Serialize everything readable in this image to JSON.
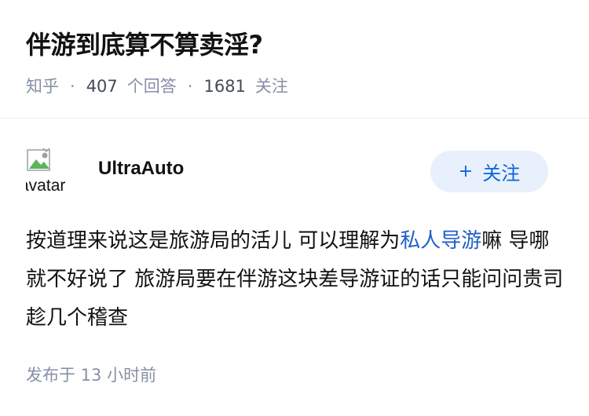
{
  "question": {
    "title": "伴游到底算不算卖淫?",
    "source": "知乎",
    "answers_count": "407",
    "answers_label": "个回答",
    "followers_count": "1681",
    "followers_label": "关注"
  },
  "answer": {
    "author": {
      "name": "UltraAuto",
      "avatar_alt": "avatar"
    },
    "follow_button": {
      "icon": "plus-icon",
      "plus_symbol": "+",
      "label": "关注"
    },
    "content": {
      "text_before_link": "按道理来说这是旅游局的活儿 可以理解为",
      "link_text": "私人导游",
      "text_after_link": "嘛 导哪就不好说了 旅游局要在伴游这块差导游证的话只能问问贵司趁几个稽查"
    },
    "publish_time": "发布于 13 小时前"
  },
  "colors": {
    "link": "#1f5fc9",
    "follow_bg": "#e8f0fb",
    "follow_text": "#0e63d8",
    "meta": "#8590a6"
  }
}
